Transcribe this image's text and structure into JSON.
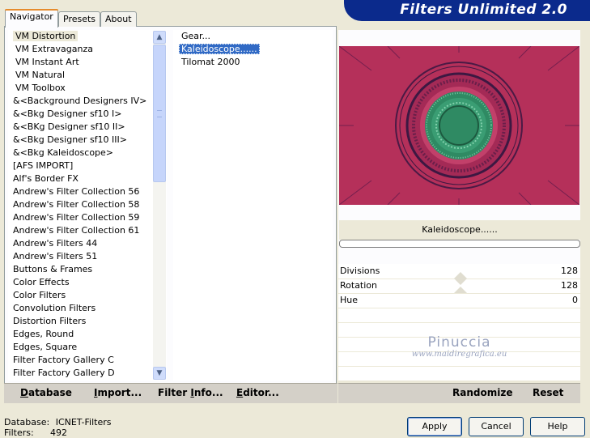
{
  "app_title": "Filters Unlimited 2.0",
  "tabs": [
    {
      "label": "Navigator"
    },
    {
      "label": "Presets"
    },
    {
      "label": "About"
    }
  ],
  "categories": [
    "VM Distortion",
    "VM Extravaganza",
    "VM Instant Art",
    "VM Natural",
    "VM Toolbox",
    "&<Background Designers IV>",
    "&<Bkg Designer sf10 I>",
    "&<BKg Designer sf10 II>",
    "&<Bkg Designer sf10 III>",
    "&<Bkg Kaleidoscope>",
    "[AFS IMPORT]",
    "Alf's Border FX",
    "Andrew's Filter Collection 56",
    "Andrew's Filter Collection 58",
    "Andrew's Filter Collection 59",
    "Andrew's Filter Collection 61",
    "Andrew's Filters 44",
    "Andrew's Filters 51",
    "Buttons & Frames",
    "Color Effects",
    "Color Filters",
    "Convolution Filters",
    "Distortion Filters",
    "Edges, Round",
    "Edges, Square",
    "Filter Factory Gallery C",
    "Filter Factory Gallery D"
  ],
  "selected_category": "VM Distortion",
  "filters": [
    "Gear...",
    "Kaleidoscope......",
    "Tilomat 2000"
  ],
  "selected_filter": "Kaleidoscope......",
  "left_buttons": {
    "database": {
      "underlined": "D",
      "rest": "atabase"
    },
    "import": {
      "underlined": "I",
      "rest": "mport..."
    },
    "filter_info": {
      "before": "Filter ",
      "underlined": "I",
      "rest": "nfo..."
    },
    "editor": {
      "underlined": "E",
      "rest": "ditor..."
    }
  },
  "preview_filter_name": "Kaleidoscope......",
  "params": [
    {
      "label": "Divisions",
      "value": "128"
    },
    {
      "label": "Rotation",
      "value": "128"
    },
    {
      "label": "Hue",
      "value": "0"
    }
  ],
  "right_buttons": {
    "randomize": "Randomize",
    "reset": "Reset"
  },
  "watermark": {
    "name": "Pinuccia",
    "url": "www.maidiregrafica.eu"
  },
  "status": {
    "database_label": "Database:",
    "database_value": "ICNET-Filters",
    "filters_label": "Filters:",
    "filters_value": "492"
  },
  "dialog_buttons": {
    "apply": "Apply",
    "cancel": "Cancel",
    "help": "Help"
  },
  "colors": {
    "banner": "#0b2a8c",
    "selection": "#316ac5",
    "preview_bg": "#b5305a",
    "ring_green": "#2f8a63"
  },
  "icons": {
    "scroll_up": "chevron-up-icon",
    "scroll_down": "chevron-down-icon"
  }
}
